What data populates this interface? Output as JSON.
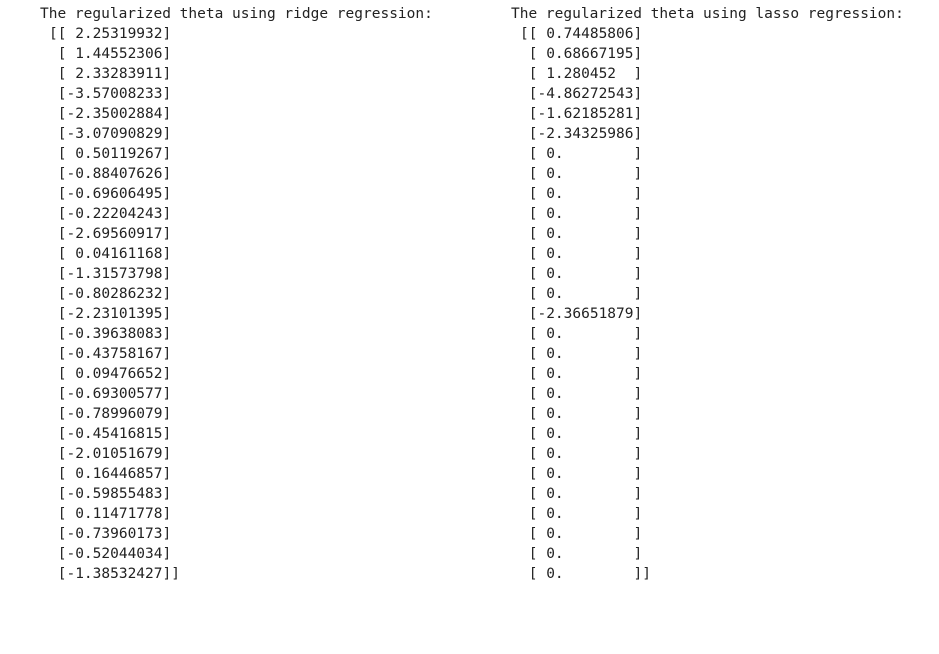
{
  "ridge": {
    "title": "The regularized theta using ridge regression:",
    "rows": [
      "[[ 2.25319932]",
      " [ 1.44552306]",
      " [ 2.33283911]",
      " [-3.57008233]",
      " [-2.35002884]",
      " [-3.07090829]",
      " [ 0.50119267]",
      " [-0.88407626]",
      " [-0.69606495]",
      " [-0.22204243]",
      " [-2.69560917]",
      " [ 0.04161168]",
      " [-1.31573798]",
      " [-0.80286232]",
      " [-2.23101395]",
      " [-0.39638083]",
      " [-0.43758167]",
      " [ 0.09476652]",
      " [-0.69300577]",
      " [-0.78996079]",
      " [-0.45416815]",
      " [-2.01051679]",
      " [ 0.16446857]",
      " [-0.59855483]",
      " [ 0.11471778]",
      " [-0.73960173]",
      " [-0.52044034]",
      " [-1.38532427]]"
    ]
  },
  "lasso": {
    "title": "The regularized theta using lasso regression:",
    "rows": [
      "[[ 0.74485806]",
      " [ 0.68667195]",
      " [ 1.280452  ]",
      " [-4.86272543]",
      " [-1.62185281]",
      " [-2.34325986]",
      " [ 0.        ]",
      " [ 0.        ]",
      " [ 0.        ]",
      " [ 0.        ]",
      " [ 0.        ]",
      " [ 0.        ]",
      " [ 0.        ]",
      " [ 0.        ]",
      " [-2.36651879]",
      " [ 0.        ]",
      " [ 0.        ]",
      " [ 0.        ]",
      " [ 0.        ]",
      " [ 0.        ]",
      " [ 0.        ]",
      " [ 0.        ]",
      " [ 0.        ]",
      " [ 0.        ]",
      " [ 0.        ]",
      " [ 0.        ]",
      " [ 0.        ]",
      " [ 0.        ]]"
    ]
  }
}
